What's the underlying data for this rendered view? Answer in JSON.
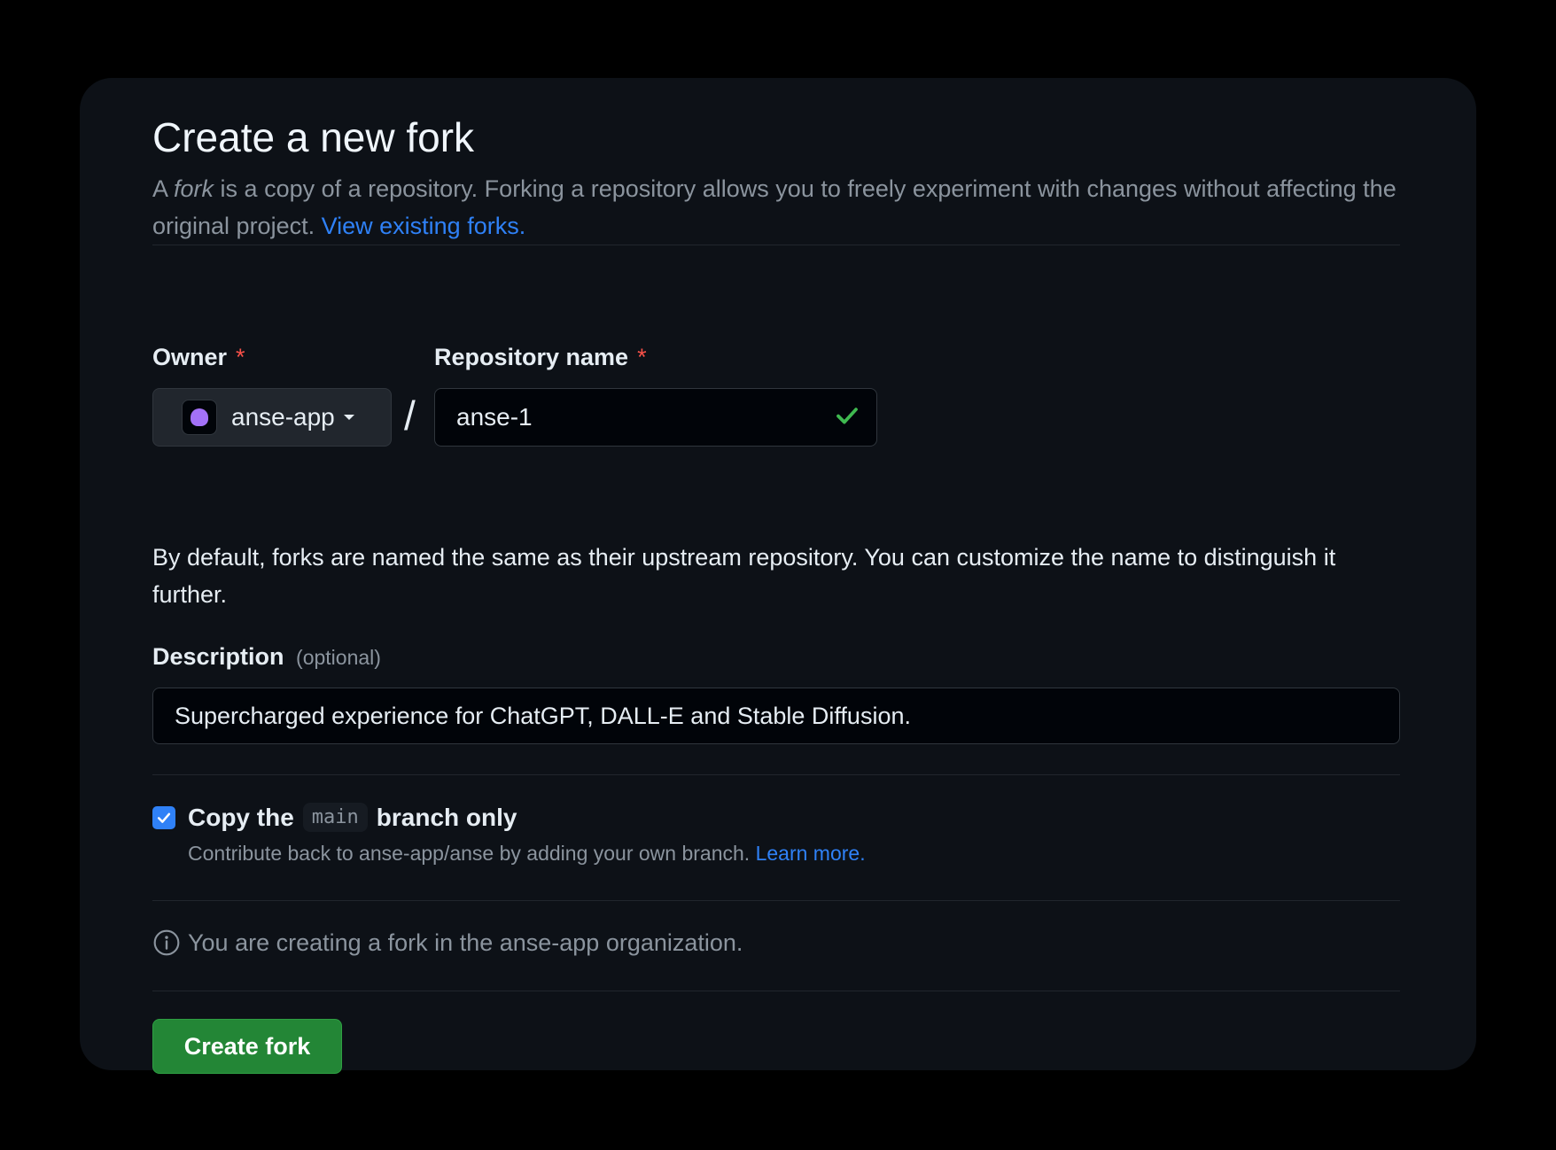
{
  "page": {
    "title": "Create a new fork",
    "subtitle_a": "A ",
    "subtitle_fork": "fork",
    "subtitle_b": " is a copy of a repository. Forking a repository allows you to freely experiment with changes without affecting the original project. ",
    "view_forks_link": "View existing forks."
  },
  "owner": {
    "label": "Owner",
    "required_mark": "*",
    "value": "anse-app"
  },
  "repo": {
    "label": "Repository name",
    "required_mark": "*",
    "value": "anse-1",
    "valid": true
  },
  "slash": "/",
  "name_help": "By default, forks are named the same as their upstream repository. You can customize the name to distinguish it further.",
  "description": {
    "label": "Description",
    "optional": "(optional)",
    "value": "Supercharged experience for ChatGPT, DALL-E and Stable Diffusion."
  },
  "copy_branch": {
    "checked": true,
    "label_a": "Copy the",
    "branch": "main",
    "label_b": "branch only",
    "help": "Contribute back to anse-app/anse by adding your own branch. ",
    "learn_more": "Learn more."
  },
  "info": {
    "text": "You are creating a fork in the anse-app organization."
  },
  "create_button": "Create fork",
  "colors": {
    "accent": "#2f81f7",
    "primary_button": "#238636",
    "success_check": "#3fb950",
    "required": "#f85149",
    "background": "#0d1117"
  }
}
